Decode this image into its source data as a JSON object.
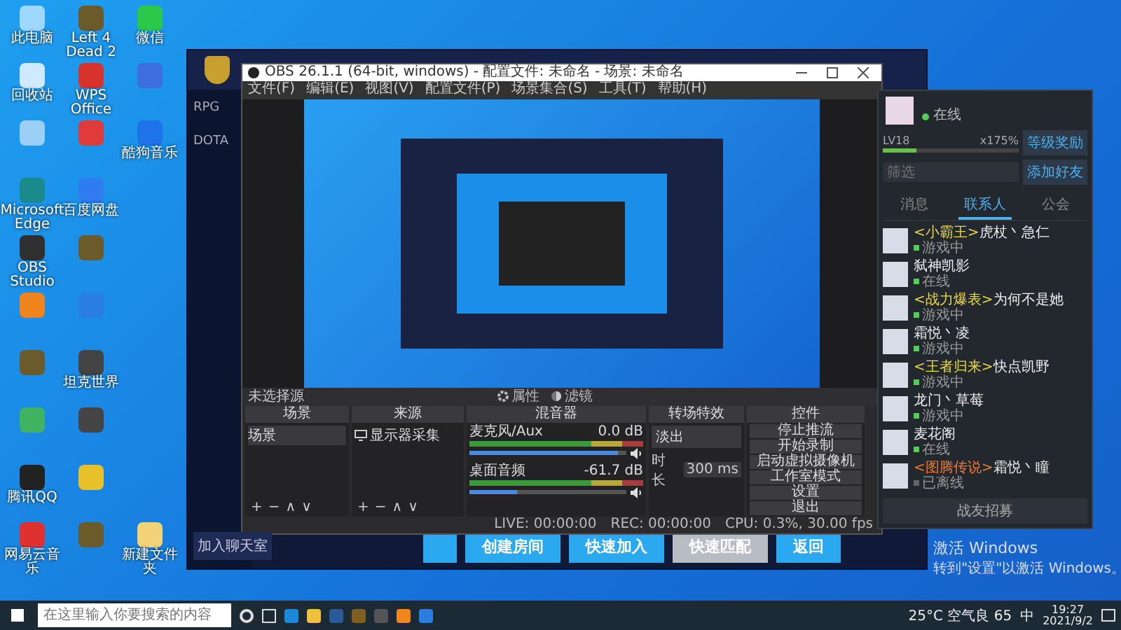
{
  "desktop": {
    "icons": [
      {
        "label": "此电脑",
        "kind": "pc"
      },
      {
        "label": "Left 4 Dead 2",
        "kind": "game"
      },
      {
        "label": "微信",
        "kind": "chat"
      },
      {
        "label": "回收站",
        "kind": "bin"
      },
      {
        "label": "WPS Office",
        "kind": "office"
      },
      {
        "kind": "bird"
      },
      {
        "kind": "folder"
      },
      {
        "kind": "music"
      },
      {
        "label": "酷狗音乐",
        "kind": "k"
      },
      {
        "label": "Microsoft Edge",
        "kind": "edge"
      },
      {
        "label": "百度网盘",
        "kind": "cloud"
      },
      {
        "kind": "none"
      },
      {
        "label": "OBS Studio",
        "kind": "obs"
      },
      {
        "kind": "game"
      },
      {
        "kind": "none"
      },
      {
        "kind": "orange"
      },
      {
        "kind": "blue"
      },
      {
        "kind": "none"
      },
      {
        "kind": "game"
      },
      {
        "label": "坦克世界",
        "kind": "tank"
      },
      {
        "kind": "none"
      },
      {
        "kind": "green"
      },
      {
        "kind": "tank"
      },
      {
        "kind": "none"
      },
      {
        "label": "腾讯QQ",
        "kind": "qq"
      },
      {
        "kind": "yellow"
      },
      {
        "kind": "none"
      },
      {
        "label": "网易云音乐",
        "kind": "red"
      },
      {
        "kind": "game"
      },
      {
        "label": "新建文件夹",
        "kind": "file"
      }
    ]
  },
  "game": {
    "sidebar": [
      {
        "label": "RPG"
      },
      {
        "label": "DOTA"
      }
    ],
    "join_chat": "加入聊天室",
    "buttons": [
      {
        "label": "创建房间",
        "selected": false
      },
      {
        "label": "快速加入",
        "selected": false
      },
      {
        "label": "快速匹配",
        "selected": true
      },
      {
        "label": "返回",
        "selected": false
      }
    ]
  },
  "obs": {
    "title": "OBS 26.1.1 (64-bit, windows) - 配置文件: 未命名 - 场景: 未命名",
    "menu": [
      "文件(F)",
      "编辑(E)",
      "视图(V)",
      "配置文件(P)",
      "场景集合(S)",
      "工具(T)",
      "帮助(H)"
    ],
    "source_bar": {
      "label": "未选择源",
      "properties": "属性",
      "filters": "滤镜"
    },
    "docks": {
      "scenes": "场景",
      "sources": "来源",
      "mixer": "混音器",
      "transitions": "转场特效",
      "controls": "控件"
    },
    "scenes": [
      "场景"
    ],
    "sources": [
      "显示器采集"
    ],
    "scene_toolbar": [
      "+",
      "−",
      "∧",
      "∨"
    ],
    "source_toolbar": [
      "+",
      "−",
      "∧",
      "∨"
    ],
    "channels": [
      {
        "name": "麦克风/Aux",
        "reading": "0.0 dB",
        "level": 0.95
      },
      {
        "name": "桌面音频",
        "reading": "-61.7 dB",
        "level": 0.3
      }
    ],
    "transition": {
      "value": "淡出",
      "duration_label": "时长",
      "duration": "300 ms"
    },
    "controls": [
      "停止推流",
      "开始录制",
      "启动虚拟摄像机",
      "工作室模式",
      "设置",
      "退出"
    ],
    "status": {
      "live": "LIVE: 00:00:00",
      "rec": "REC: 00:00:00",
      "cpu": "CPU: 0.3%, 30.00 fps"
    }
  },
  "chat": {
    "xp": {
      "label": "LV18",
      "bonus": "x175%",
      "level": 0.25
    },
    "status": "在线",
    "reward_button": "等级奖励",
    "add_friend_button": "添加好友",
    "search_placeholder": "筛选",
    "tabs": [
      {
        "label": "消息",
        "selected": false
      },
      {
        "label": "联系人",
        "selected": true
      },
      {
        "label": "公会",
        "selected": false
      }
    ],
    "contacts": [
      {
        "tag": "<小霸王>",
        "color": "#e8d84a",
        "name": "虎杖丶急仁",
        "status": "游戏中",
        "online": true
      },
      {
        "name": "弑神凯影",
        "status": "在线",
        "online": true
      },
      {
        "tag": "<战力爆表>",
        "color": "#e8d84a",
        "name": "为何不是她",
        "status": "游戏中",
        "online": true
      },
      {
        "name": "霜悦丶凌",
        "status": "游戏中",
        "online": true
      },
      {
        "tag": "<王者归来>",
        "color": "#e8d84a",
        "name": "快点凯野",
        "status": "游戏中",
        "online": true
      },
      {
        "name": "龙门丶草莓",
        "status": "游戏中",
        "online": true
      },
      {
        "name": "麦花阁",
        "status": "在线",
        "online": true
      },
      {
        "tag": "<图腾传说>",
        "color": "#f07a30",
        "name": "霜悦丶瞳",
        "status": "已离线",
        "online": false
      }
    ],
    "recruit_button": "战友招募"
  },
  "activation": {
    "title": "激活 Windows",
    "subtitle": "转到\"设置\"以激活 Windows。"
  },
  "taskbar": {
    "search_placeholder": "在这里输入你要搜索的内容",
    "weather": "25°C 空气良 65",
    "ime": "中",
    "time": "19:27",
    "date": "2021/9/2"
  }
}
